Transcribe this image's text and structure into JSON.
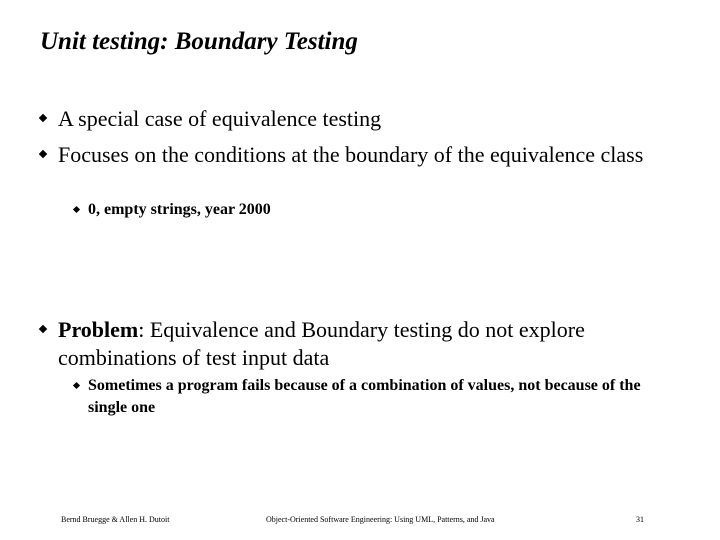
{
  "slide": {
    "title": "Unit testing: Boundary Testing",
    "bullets": [
      {
        "text": "A special case of equivalence testing"
      },
      {
        "text": "Focuses on the conditions at the boundary of the equivalence class"
      },
      {
        "sub_text": "0, empty strings, year 2000"
      },
      {
        "bold_lead": "Problem",
        "text": ": Equivalence and Boundary testing do not explore combinations of test input data"
      },
      {
        "sub_text": "Sometimes a program fails because of a combination of values, not because of the single one"
      }
    ]
  },
  "footer": {
    "authors": "Bernd Bruegge & Allen H. Dutoit",
    "book": "Object-Oriented Software Engineering: Using UML, Patterns, and Java",
    "page": "31"
  }
}
